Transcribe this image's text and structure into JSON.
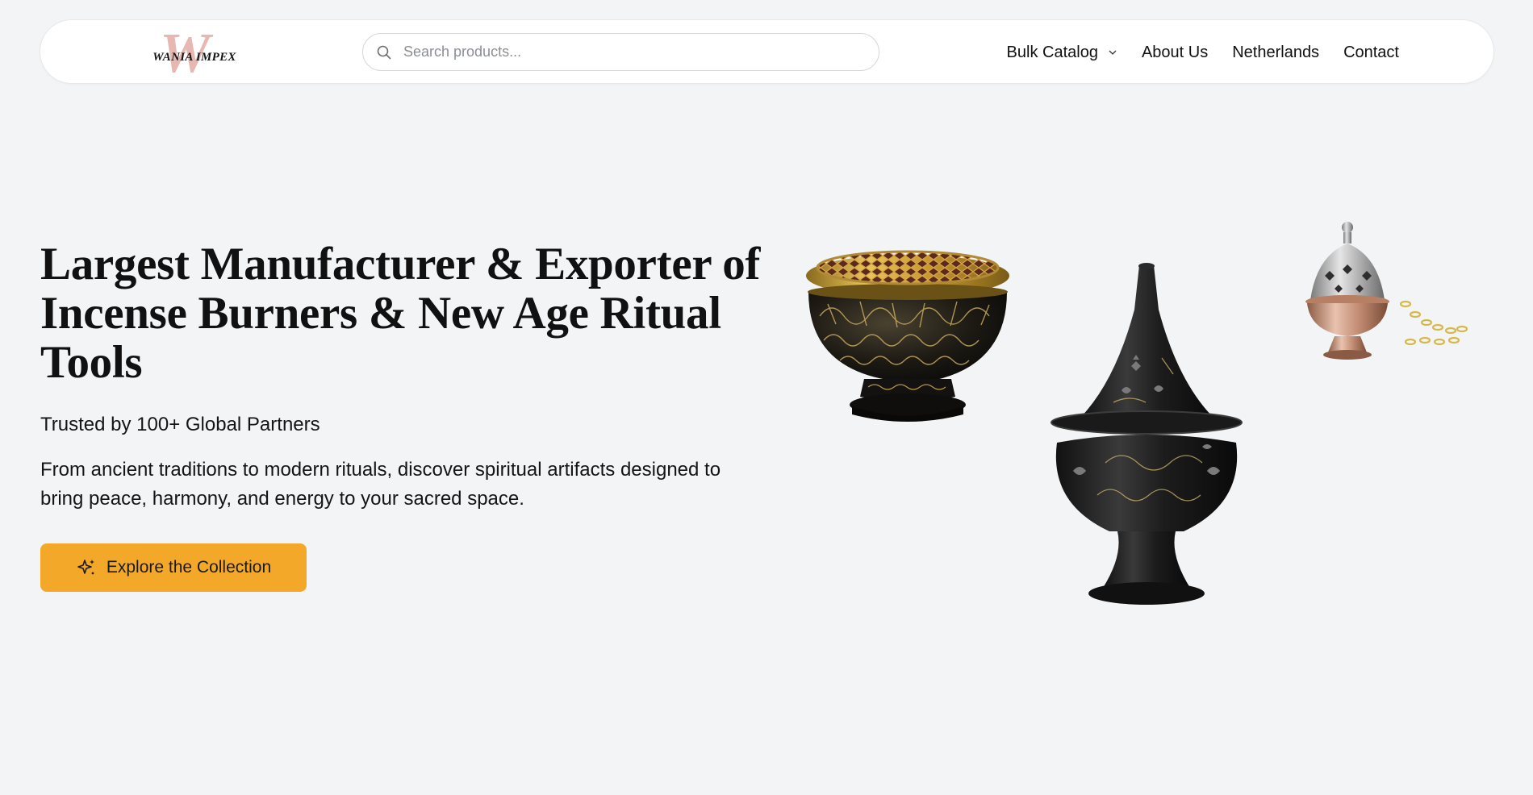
{
  "header": {
    "logo": {
      "text": "WANIA IMPEX",
      "mark": "W"
    },
    "search": {
      "placeholder": "Search products...",
      "value": ""
    },
    "nav": [
      {
        "label": "Bulk Catalog",
        "has_dropdown": true
      },
      {
        "label": "About Us"
      },
      {
        "label": "Netherlands"
      },
      {
        "label": "Contact"
      }
    ]
  },
  "hero": {
    "title": "Largest Manufacturer & Exporter of Incense Burners & New Age Ritual Tools",
    "trusted": "Trusted by 100+ Global Partners",
    "description": "From ancient traditions to modern rituals, discover spiritual artifacts designed to bring peace, harmony, and energy to your sacred space.",
    "cta_label": "Explore the Collection",
    "cta_icon": "sparkles-icon"
  },
  "products": [
    {
      "name": "brass-bowl-burner",
      "icon": "bowl-burner-image"
    },
    {
      "name": "cone-incense-burner",
      "icon": "cone-burner-image"
    },
    {
      "name": "hanging-censer",
      "icon": "hanging-censer-image"
    }
  ],
  "colors": {
    "background": "#f3f4f5",
    "header_bg": "#ffffff",
    "accent": "#f4a82a",
    "logo_mark": "#e7b8b2",
    "text": "#111111"
  }
}
